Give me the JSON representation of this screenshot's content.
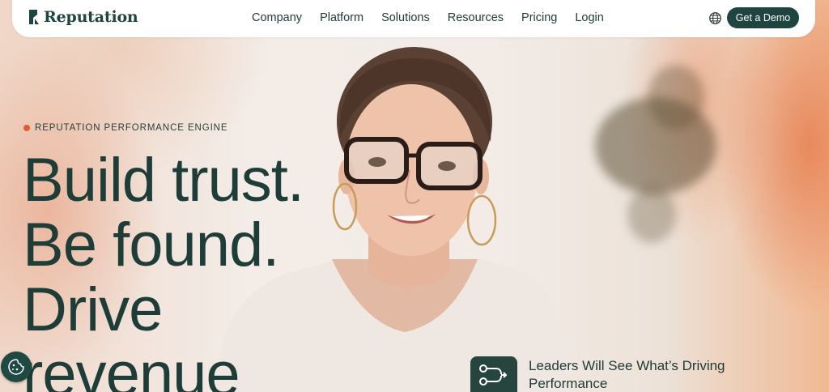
{
  "brand": {
    "name": "Reputation"
  },
  "nav": {
    "links": [
      "Company",
      "Platform",
      "Solutions",
      "Resources",
      "Pricing",
      "Login"
    ],
    "cta_label": "Get a Demo"
  },
  "hero": {
    "eyebrow": "REPUTATION PERFORMANCE ENGINE",
    "headline_lines": [
      "Build trust.",
      "Be found.",
      "Drive",
      "revenue"
    ]
  },
  "feature": {
    "text": "Leaders Will See What’s Driving Performance"
  },
  "colors": {
    "brand_dark": "#1f4540",
    "accent_orange": "#e35c2e",
    "text_dark": "#1e3d39",
    "nav_bg": "#ffffff"
  },
  "icons": {
    "globe": "globe-icon",
    "cookie": "cookie-icon",
    "feature": "workflow-icon"
  }
}
